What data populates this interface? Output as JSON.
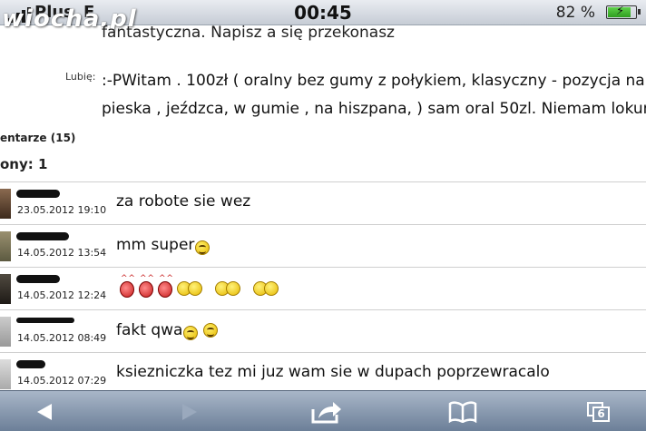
{
  "status_bar": {
    "carrier": "Plus",
    "network": "E",
    "watermark": "wiocha.pl",
    "time": "00:45",
    "battery_percent": "82 %",
    "battery_level": 0.82
  },
  "profile": {
    "truncated_line": "fantastyczna. Napisz a się przekonasz",
    "likes_label": "Lubię:",
    "likes_lines": [
      ":-PWitam . 100zł ( oralny bez gumy z połykiem, klasyczny - pozycja na",
      "pieska , jeźdzca, w gumie , na hiszpana, ) sam oral 50zl. Niemam lokum"
    ]
  },
  "comments_section": {
    "heading": "entarze (15)",
    "page_line": "ony:  1",
    "comments": [
      {
        "date": "23.05.2012 19:10",
        "text": "za robote sie wez",
        "emoticons": []
      },
      {
        "date": "14.05.2012 13:54",
        "text": "mm super",
        "emoticons": [
          "smiley-icon"
        ]
      },
      {
        "date": "14.05.2012 12:24",
        "text": "",
        "emoticons": [
          "devil-icon",
          "devil-icon",
          "devil-icon",
          "laughing-icon",
          "laughing-icon",
          "laughing-icon"
        ]
      },
      {
        "date": "14.05.2012 08:49",
        "text": "fakt qwa",
        "emoticons": [
          "smiley-icon",
          "smiley-icon"
        ]
      },
      {
        "date": "14.05.2012 07:29",
        "text": "ksiezniczka tez mi juz wam sie w dupach poprzewracalo",
        "emoticons": []
      }
    ]
  },
  "toolbar": {
    "items": [
      "back-icon",
      "forward-icon",
      "share-icon",
      "bookmarks-icon",
      "pages-icon"
    ],
    "pages_count": "6"
  }
}
